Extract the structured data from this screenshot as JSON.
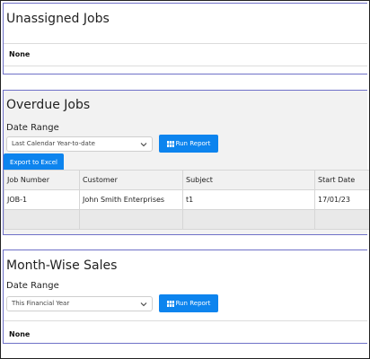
{
  "unassigned": {
    "title": "Unassigned Jobs",
    "empty_text": "None"
  },
  "overdue": {
    "title": "Overdue Jobs",
    "date_range_label": "Date Range",
    "date_range_value": "Last Calendar Year-to-date",
    "run_report_label": "Run Report",
    "export_label": "Export to Excel",
    "columns": [
      "Job Number",
      "Customer",
      "Subject",
      "Start Date"
    ],
    "rows": [
      [
        "JOB-1",
        "John Smith Enterprises",
        "t1",
        "17/01/23"
      ]
    ]
  },
  "monthwise": {
    "title": "Month-Wise Sales",
    "date_range_label": "Date Range",
    "date_range_value": "This Financial Year",
    "run_report_label": "Run Report",
    "empty_text": "None"
  },
  "colors": {
    "accent": "#0d84ee",
    "panel_border": "#6f71c8",
    "panel_bg_grey": "#f2f2f2"
  },
  "icons": [
    "table-grid-icon",
    "chevron-down-icon"
  ]
}
